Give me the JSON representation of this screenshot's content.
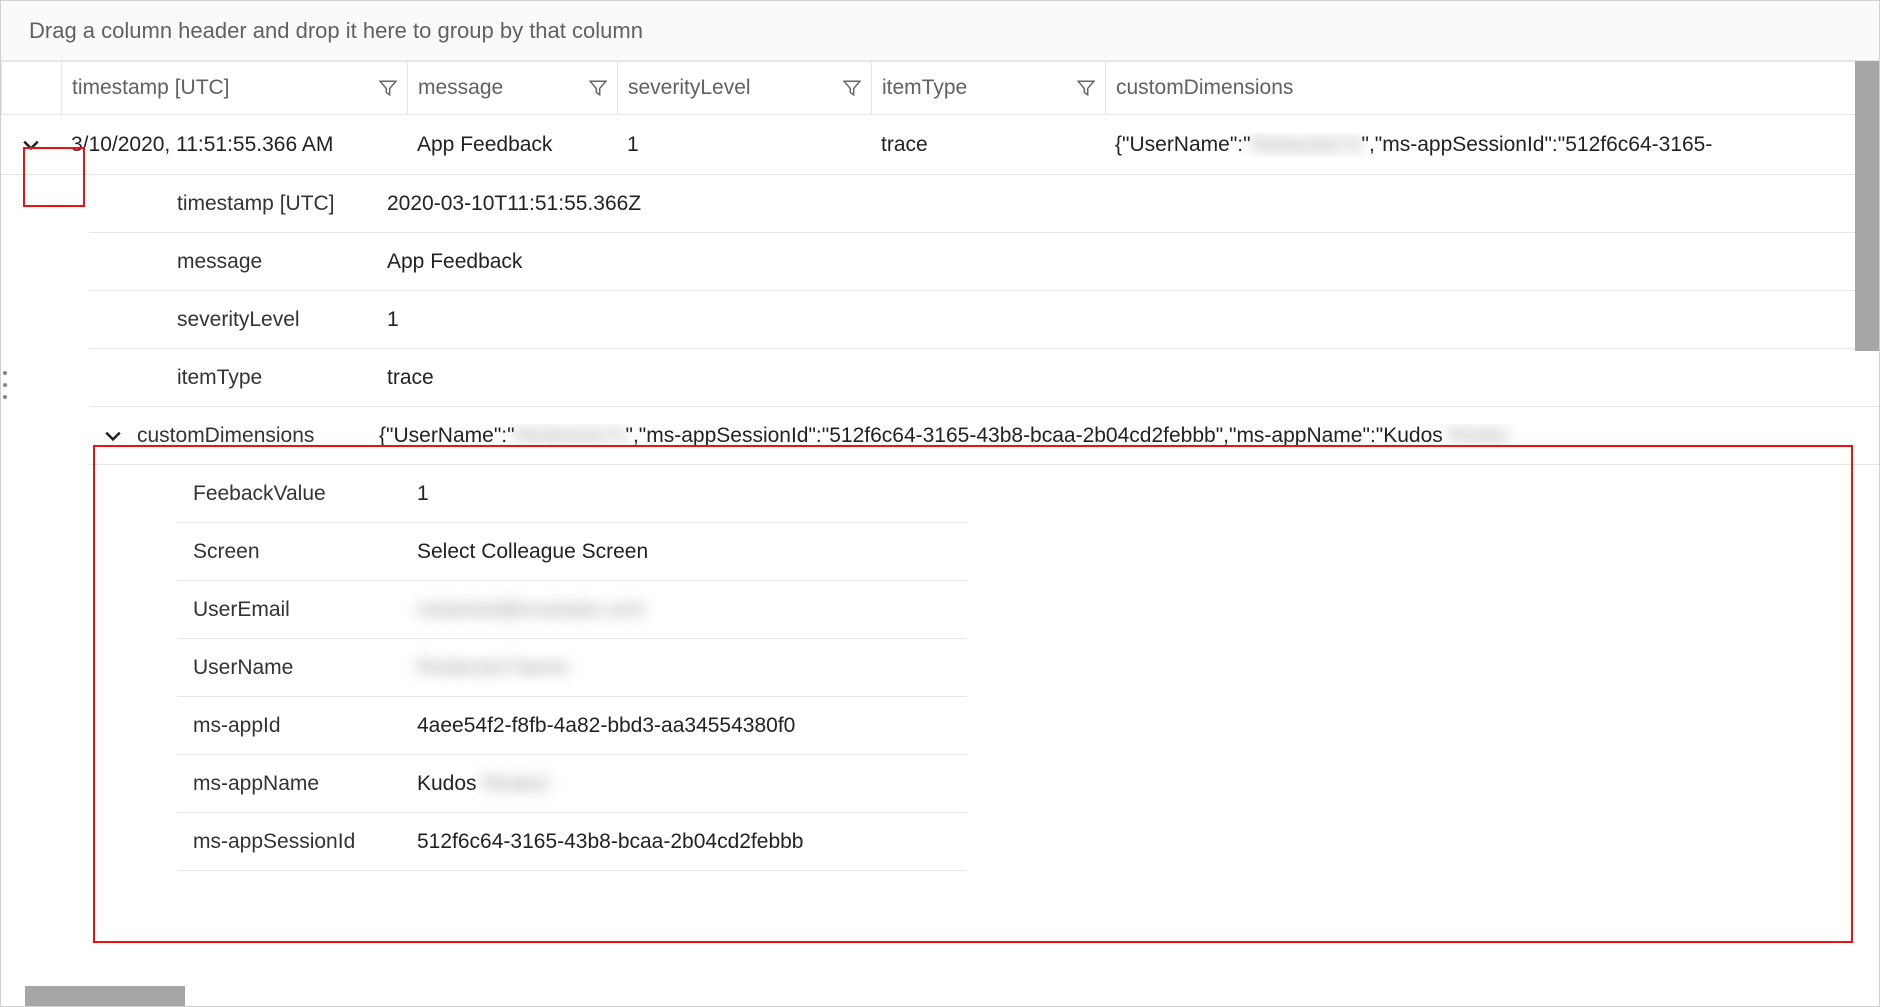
{
  "groupBar": {
    "hint": "Drag a column header and drop it here to group by that column"
  },
  "columns": {
    "timestamp": "timestamp [UTC]",
    "message": "message",
    "severity": "severityLevel",
    "itemType": "itemType",
    "customDimensions": "customDimensions"
  },
  "row": {
    "timestamp": "3/10/2020, 11:51:55.366 AM",
    "message": "App Feedback",
    "severity": "1",
    "itemType": "trace",
    "customDimensionsPreview": "{\"UserName\":\"██████\",\"ms-appSessionId\":\"512f6c64-3165-"
  },
  "details": {
    "timestamp_k": "timestamp [UTC]",
    "timestamp_v": "2020-03-10T11:51:55.366Z",
    "message_k": "message",
    "message_v": "App Feedback",
    "severity_k": "severityLevel",
    "severity_v": "1",
    "itemType_k": "itemType",
    "itemType_v": "trace",
    "cd_k": "customDimensions",
    "cd_v": "{\"UserName\":\"██████\",\"ms-appSessionId\":\"512f6c64-3165-43b8-bcaa-2b04cd2febbb\",\"ms-appName\":\"Kudos ███"
  },
  "cd": {
    "feedback_k": "FeebackValue",
    "feedback_v": "1",
    "screen_k": "Screen",
    "screen_v": "Select Colleague Screen",
    "email_k": "UserEmail",
    "email_v": "redacted@example.com",
    "user_k": "UserName",
    "user_v": "Redacted Name",
    "appid_k": "ms-appId",
    "appid_v": "4aee54f2-f8fb-4a82-bbd3-aa34554380f0",
    "appname_k": "ms-appName",
    "appname_v_prefix": "Kudos ",
    "appname_v_blur": "Redact",
    "session_k": "ms-appSessionId",
    "session_v": "512f6c64-3165-43b8-bcaa-2b04cd2febbb"
  }
}
